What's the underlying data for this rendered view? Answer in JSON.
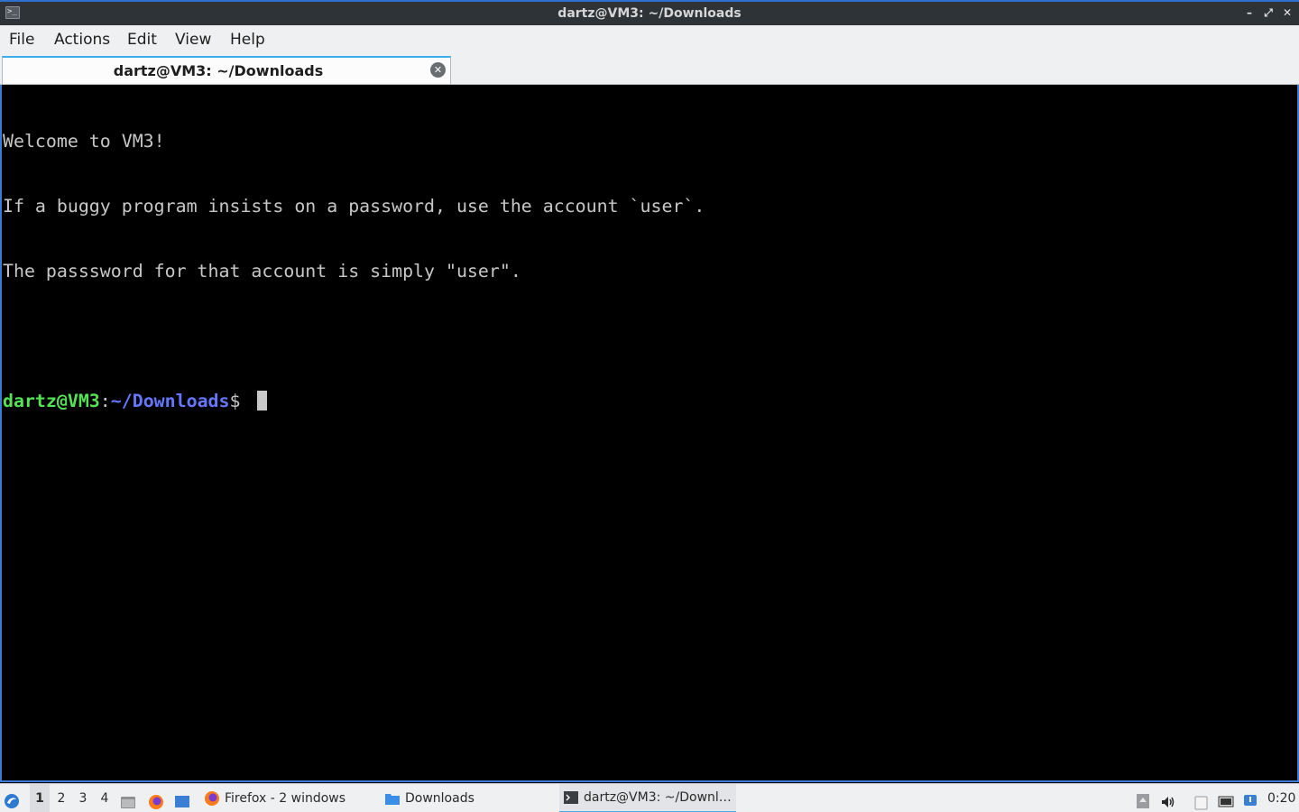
{
  "window": {
    "title": "dartz@VM3: ~/Downloads",
    "controls": {
      "minimize": "–",
      "maximize": "⤢",
      "close": "✕"
    }
  },
  "menubar": {
    "items": [
      "File",
      "Actions",
      "Edit",
      "View",
      "Help"
    ]
  },
  "tabs": [
    {
      "label": "dartz@VM3: ~/Downloads",
      "close_icon": "close-icon"
    }
  ],
  "terminal": {
    "lines": [
      "Welcome to VM3!",
      "If a buggy program insists on a password, use the account `user`.",
      "The passsword for that account is simply \"user\".",
      ""
    ],
    "prompt": {
      "user_host": "dartz@VM3",
      "separator": ":",
      "path": "~/Downloads",
      "sign": "$ "
    }
  },
  "taskbar": {
    "desktops": [
      "1",
      "2",
      "3",
      "4"
    ],
    "active_desktop": "1",
    "tasks": [
      {
        "label": "Firefox - 2 windows",
        "icon": "firefox-icon"
      },
      {
        "label": "Downloads",
        "icon": "folder-icon"
      },
      {
        "label": "dartz@VM3: ~/Downl…",
        "icon": "terminal-icon",
        "active": true
      }
    ],
    "clock": "0:20"
  }
}
